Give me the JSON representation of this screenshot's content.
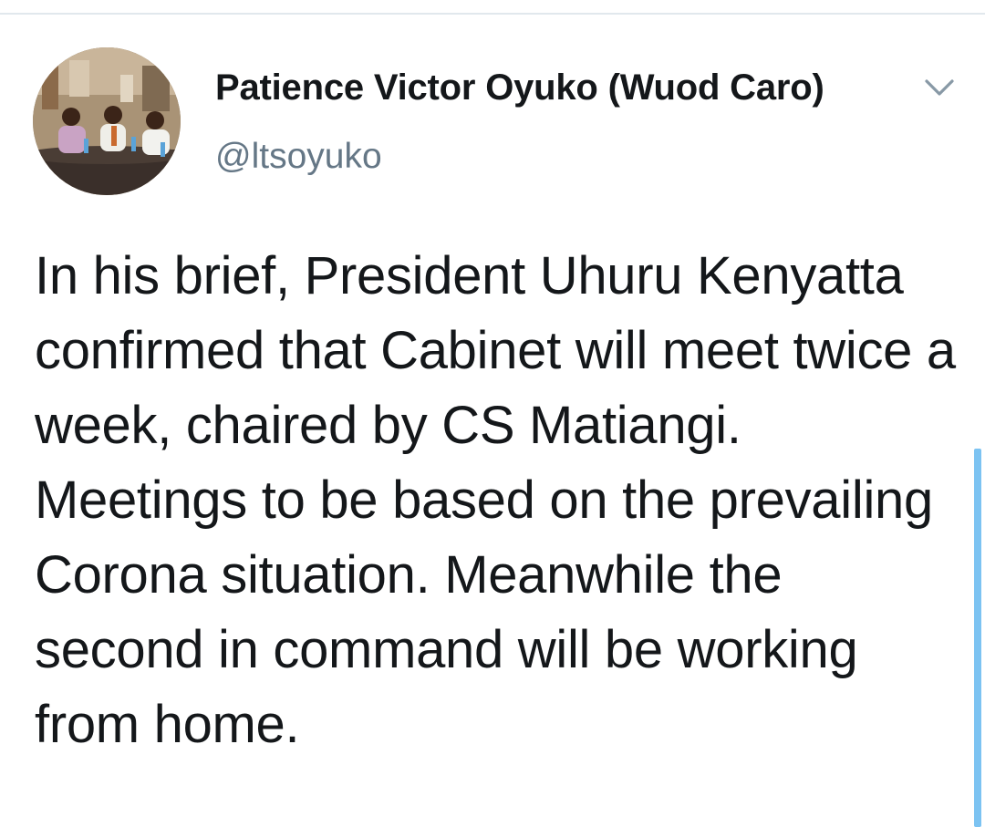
{
  "tweet": {
    "author": {
      "display_name": "Patience Victor Oyuko (Wuod Caro)",
      "handle": "@ltsoyuko",
      "avatar": "profile-photo"
    },
    "text": "In his brief, President Uhuru Kenyatta confirmed that Cabinet will meet twice a week, chaired by CS Matiangi. Meetings to be based on the prevailing Corona situation. Meanwhile the second in command will be working from home.",
    "menu_icon": "chevron-down-icon"
  },
  "colors": {
    "text_primary": "#14171a",
    "text_secondary": "#657786",
    "divider": "#e1e8ed",
    "scroll_accent": "#7cc3f2"
  }
}
